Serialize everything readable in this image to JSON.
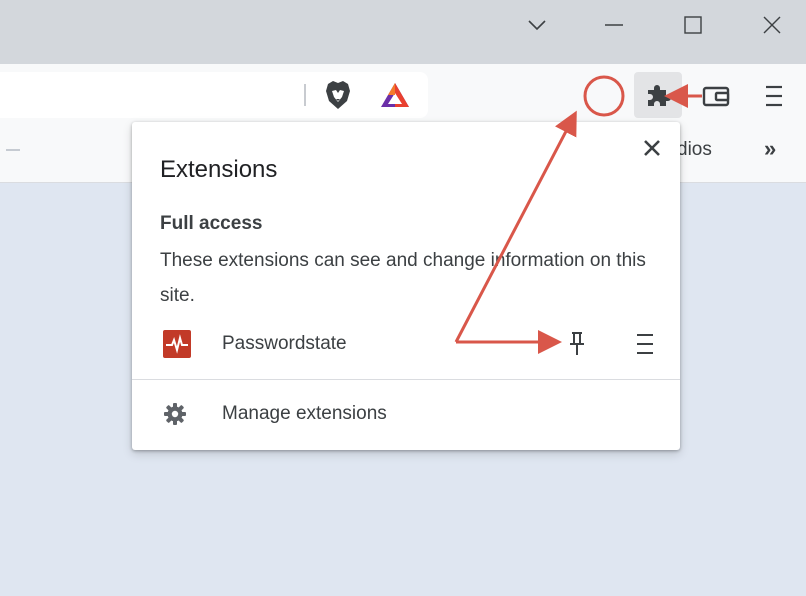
{
  "popup": {
    "title": "Extensions",
    "section_heading": "Full access",
    "section_description": "These extensions can see and change information on this site.",
    "extensions": [
      {
        "name": "Passwordstate"
      }
    ],
    "manage_label": "Manage extensions"
  },
  "bookmarks": {
    "partial_text": "dios",
    "overflow": "»"
  },
  "icons": {
    "brave_shield": "brave-lion-icon",
    "rewards": "brave-rewards-triangle-icon",
    "extensions": "puzzle-piece-icon",
    "wallet": "wallet-icon",
    "menu": "hamburger-menu-icon",
    "pin": "pin-icon",
    "gear": "gear-icon",
    "close": "close-icon"
  },
  "colors": {
    "annotation_red": "#d9574a",
    "extension_icon_bg": "#c23a28",
    "brave_orange": "#f1592a",
    "window_bg": "#dfe6f1"
  }
}
